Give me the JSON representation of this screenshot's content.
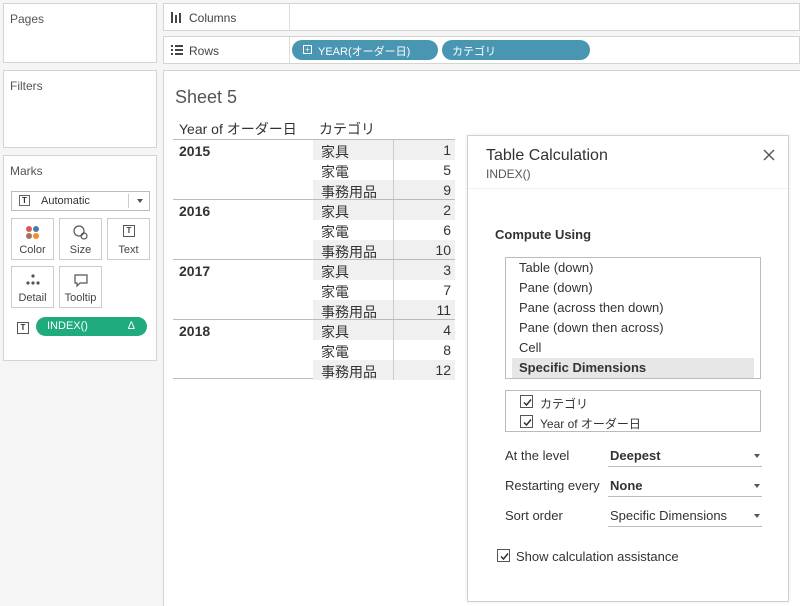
{
  "left_panel": {
    "pages_title": "Pages",
    "filters_title": "Filters",
    "marks": {
      "title": "Marks",
      "type_value": "Automatic",
      "buttons": [
        {
          "label": "Color",
          "icon": "color-dots-icon"
        },
        {
          "label": "Size",
          "icon": "size-icon"
        },
        {
          "label": "Text",
          "icon": "text-icon"
        },
        {
          "label": "Detail",
          "icon": "detail-dots-icon"
        },
        {
          "label": "Tooltip",
          "icon": "tooltip-icon"
        }
      ],
      "field_pill": {
        "label": "INDEX()",
        "badge": "Δ",
        "color": "#1fab7d"
      }
    }
  },
  "shelves": {
    "columns_label": "Columns",
    "rows_label": "Rows",
    "rows_pills": [
      {
        "label": "YEAR(オーダー日)",
        "color": "#4996b2"
      },
      {
        "label": "カテゴリ",
        "color": "#4996b2"
      }
    ]
  },
  "sheet": {
    "title": "Sheet 5",
    "headers": [
      "Year of オーダー日",
      "カテゴリ"
    ],
    "rows": [
      {
        "year": "2015",
        "items": [
          {
            "cat": "家具",
            "val": "1"
          },
          {
            "cat": "家電",
            "val": "5"
          },
          {
            "cat": "事務用品",
            "val": "9"
          }
        ]
      },
      {
        "year": "2016",
        "items": [
          {
            "cat": "家具",
            "val": "2"
          },
          {
            "cat": "家電",
            "val": "6"
          },
          {
            "cat": "事務用品",
            "val": "10"
          }
        ]
      },
      {
        "year": "2017",
        "items": [
          {
            "cat": "家具",
            "val": "3"
          },
          {
            "cat": "家電",
            "val": "7"
          },
          {
            "cat": "事務用品",
            "val": "11"
          }
        ]
      },
      {
        "year": "2018",
        "items": [
          {
            "cat": "家具",
            "val": "4"
          },
          {
            "cat": "家電",
            "val": "8"
          },
          {
            "cat": "事務用品",
            "val": "12"
          }
        ]
      }
    ]
  },
  "dialog": {
    "title": "Table Calculation",
    "subtitle": "INDEX()",
    "compute_using_label": "Compute Using",
    "compute_options": [
      "Table (down)",
      "Pane (down)",
      "Pane (across then down)",
      "Pane (down then across)",
      "Cell",
      "Specific Dimensions"
    ],
    "selected_option": "Specific Dimensions",
    "dimensions": [
      {
        "label": "カテゴリ",
        "checked": true
      },
      {
        "label": "Year of オーダー日",
        "checked": true
      }
    ],
    "at_level_label": "At the level",
    "at_level_value": "Deepest",
    "restarting_label": "Restarting every",
    "restarting_value": "None",
    "sort_label": "Sort order",
    "sort_value": "Specific Dimensions",
    "assist_label": "Show calculation assistance",
    "assist_checked": true
  }
}
